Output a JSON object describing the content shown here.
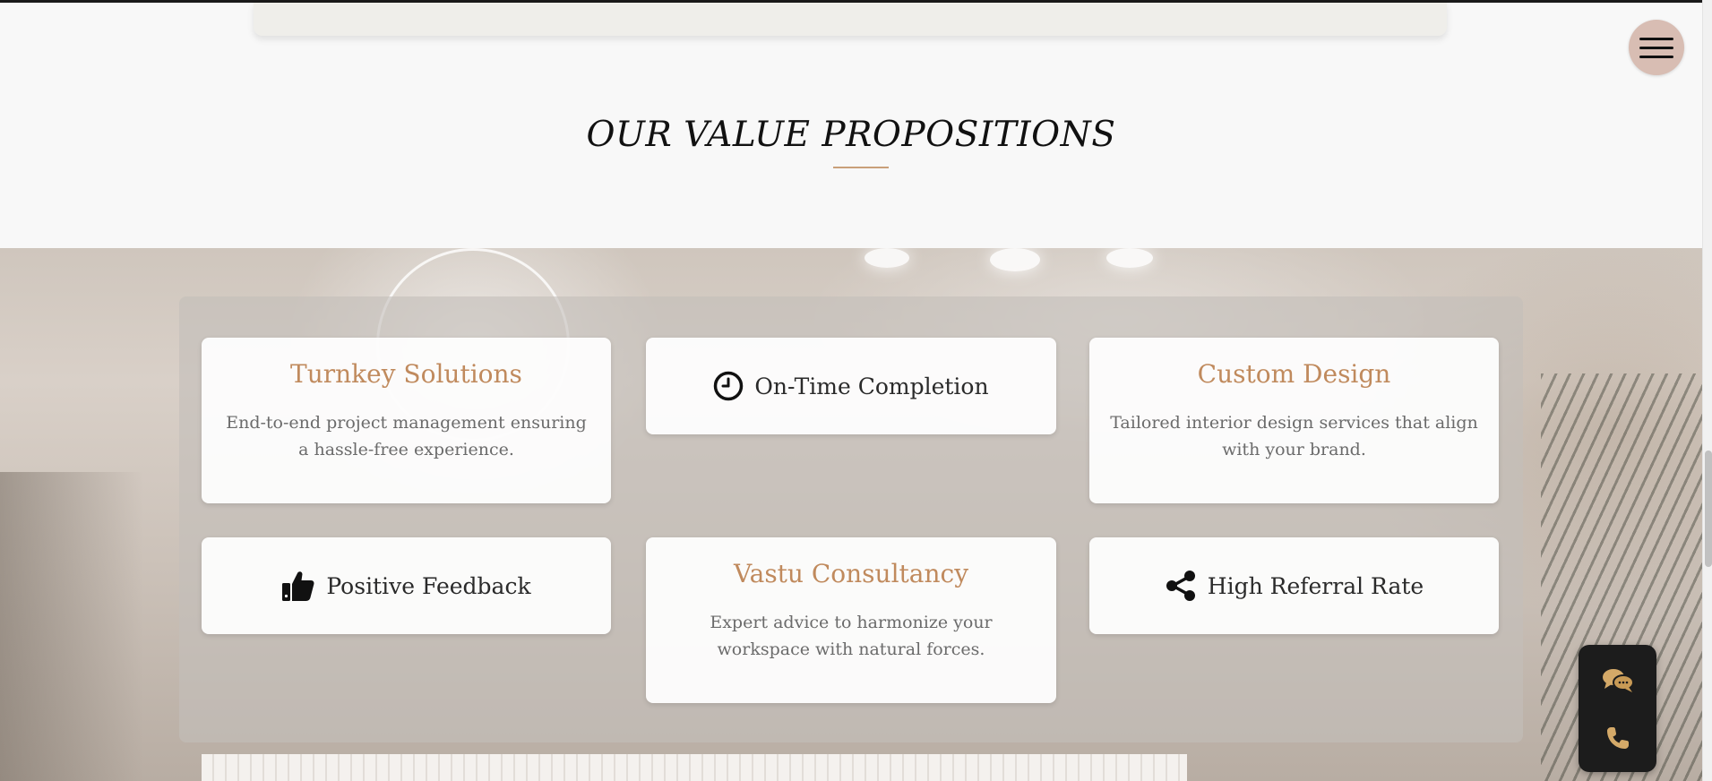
{
  "section": {
    "heading": "OUR VALUE PROPOSITIONS"
  },
  "cards": {
    "turnkey": {
      "title": "Turnkey Solutions",
      "description": "End-to-end project management ensuring a hassle-free experience."
    },
    "on_time": {
      "label": "On-Time Completion",
      "icon": "clock-icon"
    },
    "custom_design": {
      "title": "Custom Design",
      "description": "Tailored interior design services that align with your brand."
    },
    "positive_feedback": {
      "label": "Positive Feedback",
      "icon": "thumbs-up-icon"
    },
    "vastu": {
      "title": "Vastu Consultancy",
      "description": "Expert advice to harmonize your workspace with natural forces."
    },
    "referral": {
      "label": "High Referral Rate",
      "icon": "share-icon"
    }
  },
  "floating": {
    "menu_icon": "hamburger-menu-icon",
    "chat_icon": "chat-bubbles-icon",
    "phone_icon": "phone-icon"
  },
  "colors": {
    "accent": "#c08a5d",
    "menu_button_bg": "#d8bdb3",
    "contact_widget_bg": "#1c1c1c",
    "contact_icon": "#d4a968"
  }
}
